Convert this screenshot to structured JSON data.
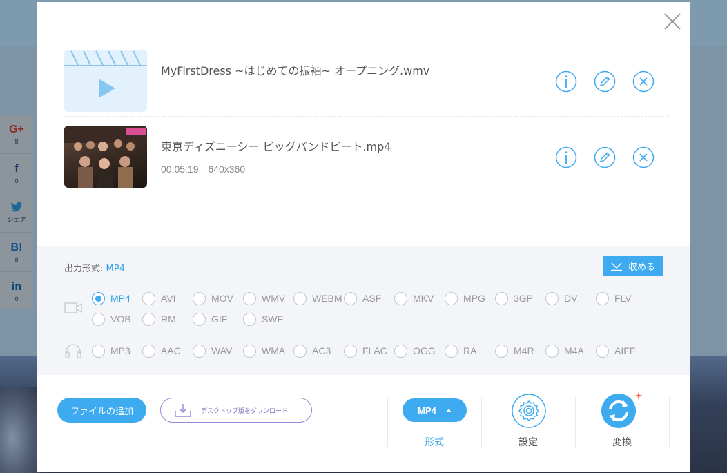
{
  "background": {
    "social": [
      {
        "icon": "G+",
        "count": "8"
      },
      {
        "icon": "f",
        "count": "0"
      },
      {
        "icon": "tw",
        "count": "シェア"
      },
      {
        "icon": "B!",
        "count": "8"
      },
      {
        "icon": "in",
        "count": "0"
      }
    ]
  },
  "modal": {
    "close_icon": "close-icon",
    "files": [
      {
        "name": "MyFirstDress ~はじめての振袖~ オープニング.wmv",
        "duration": "",
        "resolution": "",
        "thumb": "video-placeholder"
      },
      {
        "name": "東京ディズニーシー ビッグバンドビート.mp4",
        "duration": "00:05:19",
        "resolution": "640x360",
        "thumb": "photo"
      }
    ],
    "output": {
      "label": "出力形式:",
      "value": "MP4",
      "collapse_label": "収める",
      "video_formats": [
        "MP4",
        "AVI",
        "MOV",
        "WMV",
        "WEBM",
        "ASF",
        "MKV",
        "MPG",
        "3GP",
        "DV",
        "FLV",
        "VOB",
        "RM",
        "GIF",
        "SWF"
      ],
      "audio_formats": [
        "MP3",
        "AAC",
        "WAV",
        "WMA",
        "AC3",
        "FLAC",
        "OGG",
        "RA",
        "M4R",
        "M4A",
        "AIFF"
      ],
      "selected": "MP4"
    },
    "bottom": {
      "add_file": "ファイルの追加",
      "download_desktop": "デスクトップ版をダウンロード",
      "format_button": "MP4",
      "format_label": "形式",
      "settings_label": "設定",
      "convert_label": "変換"
    }
  },
  "colors": {
    "accent": "#3eaaf0",
    "selected_text": "#2fa3e8",
    "panel": "#f3f5f8"
  }
}
